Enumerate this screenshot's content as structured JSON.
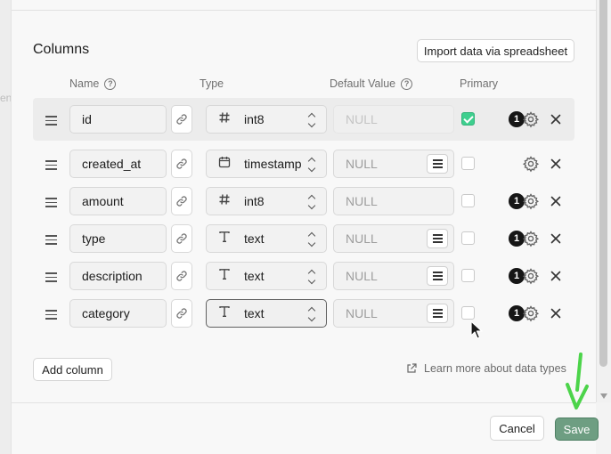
{
  "background": {
    "peek_text": "en"
  },
  "section": {
    "title": "Columns",
    "import_label": "Import data via spreadsheet"
  },
  "headers": {
    "name": "Name",
    "type": "Type",
    "default_value": "Default Value",
    "primary": "Primary"
  },
  "columns": [
    {
      "name": "id",
      "type": "int8",
      "type_icon": "hash-icon",
      "default": "NULL",
      "primary": true,
      "badge": "1",
      "default_disabled": true,
      "has_list_button": false
    },
    {
      "name": "created_at",
      "type": "timestamp",
      "type_icon": "calendar-icon",
      "default": "NULL",
      "primary": false,
      "badge": "",
      "default_disabled": false,
      "has_list_button": true
    },
    {
      "name": "amount",
      "type": "int8",
      "type_icon": "hash-icon",
      "default": "NULL",
      "primary": false,
      "badge": "1",
      "default_disabled": false,
      "has_list_button": false
    },
    {
      "name": "type",
      "type": "text",
      "type_icon": "text-icon",
      "default": "NULL",
      "primary": false,
      "badge": "1",
      "default_disabled": false,
      "has_list_button": true
    },
    {
      "name": "description",
      "type": "text",
      "type_icon": "text-icon",
      "default": "NULL",
      "primary": false,
      "badge": "1",
      "default_disabled": false,
      "has_list_button": true
    },
    {
      "name": "category",
      "type": "text",
      "type_icon": "text-icon",
      "default": "NULL",
      "primary": false,
      "badge": "1",
      "default_disabled": false,
      "has_list_button": true
    }
  ],
  "actions": {
    "add_column": "Add column",
    "learn_more": "Learn more about data types"
  },
  "footer": {
    "cancel": "Cancel",
    "save": "Save"
  },
  "colors": {
    "primary_check": "#3ecf8e",
    "save_button": "#6e9e82",
    "annotation_arrow": "#4cd44a"
  }
}
